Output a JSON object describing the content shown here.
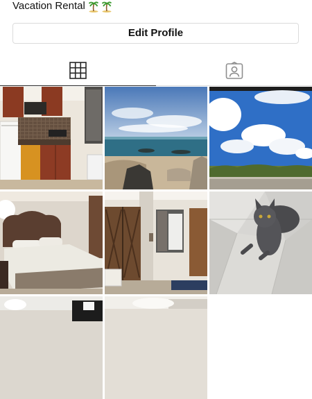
{
  "profile": {
    "bio": "Vacation Rental",
    "bio_emoji": [
      "palm-tree",
      "palm-tree"
    ],
    "edit_label": "Edit Profile"
  },
  "tabs": [
    {
      "name": "posts-grid",
      "icon": "grid-icon",
      "active": true
    },
    {
      "name": "tagged",
      "icon": "tagged-person-icon",
      "active": false
    }
  ],
  "posts": [
    {
      "subject": "kitchen"
    },
    {
      "subject": "rocky beach and sea"
    },
    {
      "subject": "blue sky with clouds"
    },
    {
      "subject": "bedroom"
    },
    {
      "subject": "room with wooden doors"
    },
    {
      "subject": "grey cat on tile floor"
    },
    {
      "subject": "room interior"
    },
    {
      "subject": "room interior"
    }
  ],
  "colors": {
    "border": "#dbdbdb",
    "active_tab": "#262626",
    "text": "#111111"
  }
}
